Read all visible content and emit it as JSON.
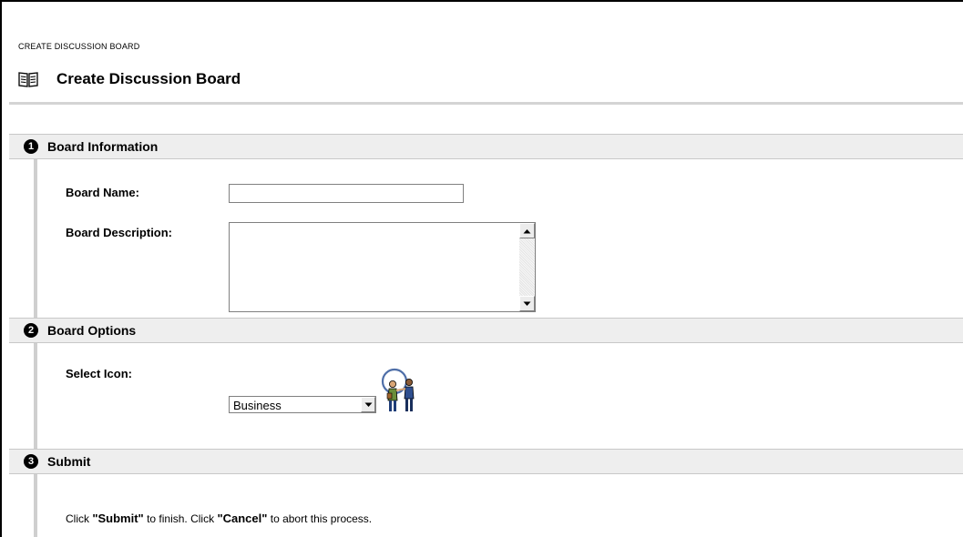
{
  "breadcrumb": "CREATE DISCUSSION BOARD",
  "page": {
    "title": "Create Discussion Board",
    "icon": "book-icon"
  },
  "sections": [
    {
      "number": "1",
      "label": "Board Information"
    },
    {
      "number": "2",
      "label": "Board Options"
    },
    {
      "number": "3",
      "label": "Submit"
    }
  ],
  "board_info": {
    "name_label": "Board Name:",
    "name_value": "",
    "description_label": "Board Description:",
    "description_value": ""
  },
  "board_options": {
    "icon_label": "Select Icon:",
    "icon_selected": "Business",
    "preview_icon": "business-people-icon"
  },
  "submit": {
    "pre": "Click ",
    "submit_word": "\"Submit\"",
    "middle": " to finish. Click ",
    "cancel_word": "\"Cancel\"",
    "post": " to abort this process."
  }
}
